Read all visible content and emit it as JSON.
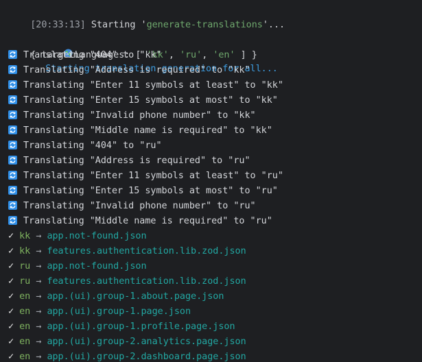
{
  "header": {
    "ts_text": "[20:33:13]",
    "starting_prefix": " Starting '",
    "task_name": "generate-translations",
    "starting_suffix": "'..."
  },
  "generation": {
    "icon": "globe-icon",
    "text": "Starting translation generation for all..."
  },
  "target_languages": {
    "prefix": "{ targetLanguages: [ ",
    "langs": [
      "'kk'",
      "'ru'",
      "'en'"
    ],
    "sep": ", ",
    "suffix": " ] }"
  },
  "translating_lines": [
    "Translating \"404\" to \"kk\"",
    "Translating \"Address is required\" to \"kk\"",
    "Translating \"Enter 11 symbols at least\" to \"kk\"",
    "Translating \"Enter 15 symbols at most\" to \"kk\"",
    "Translating \"Invalid phone number\" to \"kk\"",
    "Translating \"Middle name is required\" to \"kk\"",
    "Translating \"404\" to \"ru\"",
    "Translating \"Address is required\" to \"ru\"",
    "Translating \"Enter 11 symbols at least\" to \"ru\"",
    "Translating \"Enter 15 symbols at most\" to \"ru\"",
    "Translating \"Invalid phone number\" to \"ru\"",
    "Translating \"Middle name is required\" to \"ru\""
  ],
  "done_lines": [
    {
      "check": "✓",
      "lang": "kk",
      "arrow": "→",
      "file": "app.not-found.json"
    },
    {
      "check": "✓",
      "lang": "kk",
      "arrow": "→",
      "file": "features.authentication.lib.zod.json"
    },
    {
      "check": "✓",
      "lang": "ru",
      "arrow": "→",
      "file": "app.not-found.json"
    },
    {
      "check": "✓",
      "lang": "ru",
      "arrow": "→",
      "file": "features.authentication.lib.zod.json"
    },
    {
      "check": "✓",
      "lang": "en",
      "arrow": "→",
      "file": "app.(ui).group-1.about.page.json"
    },
    {
      "check": "✓",
      "lang": "en",
      "arrow": "→",
      "file": "app.(ui).group-1.page.json"
    },
    {
      "check": "✓",
      "lang": "en",
      "arrow": "→",
      "file": "app.(ui).group-1.profile.page.json"
    },
    {
      "check": "✓",
      "lang": "en",
      "arrow": "→",
      "file": "app.(ui).group-2.analytics.page.json"
    },
    {
      "check": "✓",
      "lang": "en",
      "arrow": "→",
      "file": "app.(ui).group-2.dashboard.page.json"
    }
  ],
  "colors": {
    "background": "#1e1f22",
    "text": "#d4d6da",
    "string": "#6fa86d",
    "info": "#3d9ce0",
    "lang": "#7fb35f",
    "path": "#22a8a3",
    "sync_icon": "#2f8fe8"
  }
}
